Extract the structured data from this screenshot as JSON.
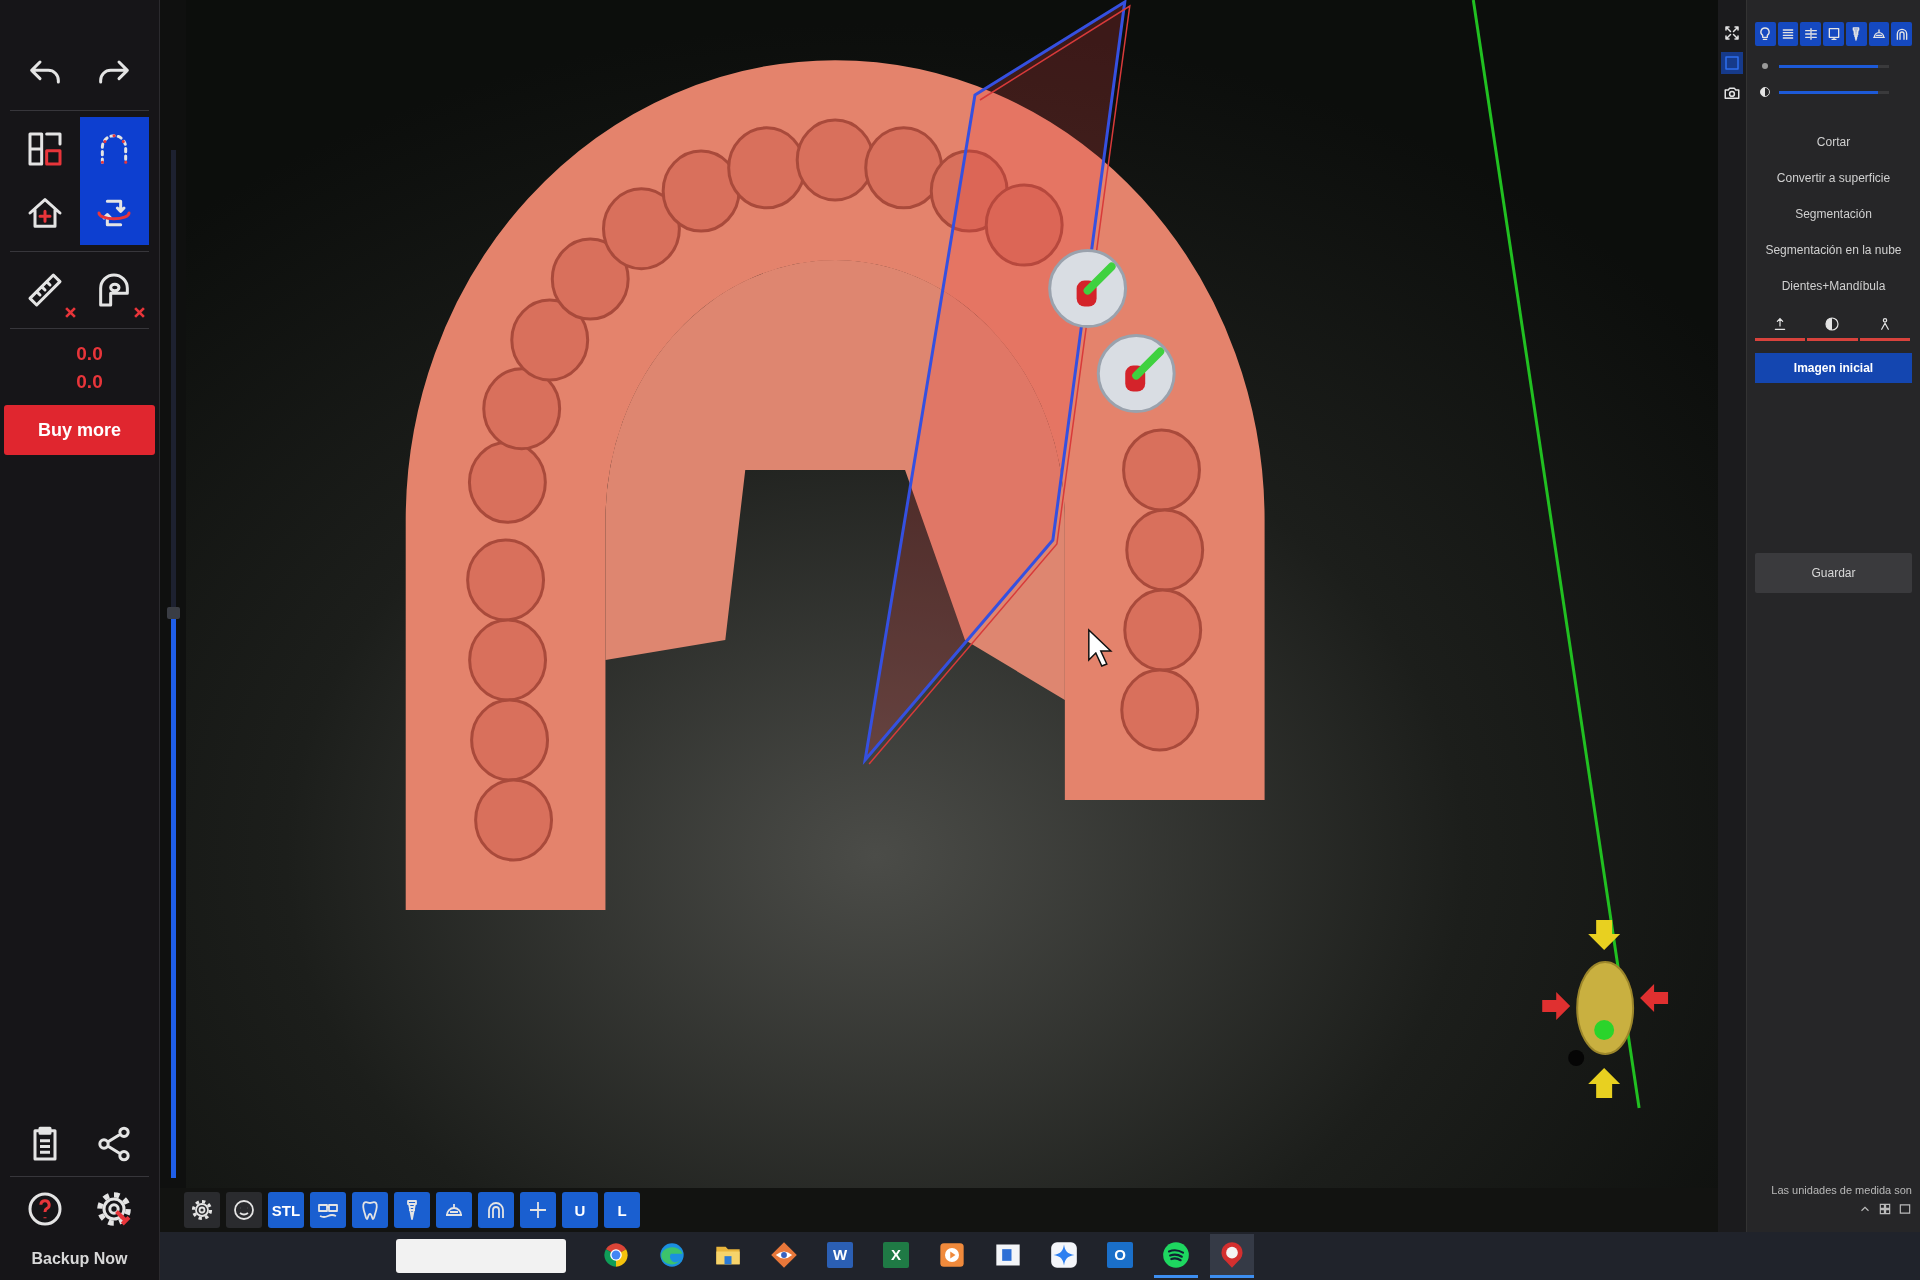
{
  "left_toolbar": {
    "tool_groups": [
      [
        {
          "kind": "undo",
          "selected": false,
          "clear_mark": false
        },
        {
          "kind": "redo",
          "selected": false,
          "clear_mark": false
        }
      ],
      [
        {
          "kind": "layout",
          "selected": false,
          "clear_mark": false
        },
        {
          "kind": "arch",
          "selected": true,
          "clear_mark": false
        },
        {
          "kind": "home",
          "selected": false,
          "clear_mark": false
        },
        {
          "kind": "rotate",
          "selected": true,
          "clear_mark": false
        }
      ],
      [
        {
          "kind": "ruler",
          "selected": false,
          "clear_mark": true
        },
        {
          "kind": "caliper",
          "selected": false,
          "clear_mark": true
        }
      ]
    ],
    "readings": [
      "0.0",
      "0.0"
    ],
    "buy_button": "Buy more",
    "bottom_tools": [
      {
        "kind": "clipboard"
      },
      {
        "kind": "share"
      },
      {
        "kind": "help"
      },
      {
        "kind": "settings"
      }
    ],
    "backup_button": "Backup Now"
  },
  "clip_slider": {
    "level": 0.55
  },
  "app_toolbar": [
    {
      "kind": "gear"
    },
    {
      "kind": "face"
    },
    {
      "kind": "label",
      "label": "STL"
    },
    {
      "kind": "glasses"
    },
    {
      "kind": "tooth"
    },
    {
      "kind": "implant"
    },
    {
      "kind": "dome"
    },
    {
      "kind": "arch2"
    },
    {
      "kind": "add"
    },
    {
      "kind": "label",
      "label": "U"
    },
    {
      "kind": "label",
      "label": "L"
    }
  ],
  "view_strip": [
    {
      "kind": "fit",
      "selected": false
    },
    {
      "kind": "frame",
      "selected": true
    },
    {
      "kind": "camera",
      "selected": false
    }
  ],
  "right_panel": {
    "tabs": [
      {
        "kind": "bulb"
      },
      {
        "kind": "lines"
      },
      {
        "kind": "flow"
      },
      {
        "kind": "screen"
      },
      {
        "kind": "implant"
      },
      {
        "kind": "dome"
      },
      {
        "kind": "arch2"
      }
    ],
    "sliders": [
      {
        "kind": "dot",
        "level": 0.9
      },
      {
        "kind": "contrast",
        "level": 0.9
      }
    ],
    "actions": [
      "Cortar",
      "Convertir a superficie",
      "Segmentación",
      "Segmentación en la nube",
      "Dientes+Mandíbula"
    ],
    "view_tabs": [
      {
        "kind": "upload"
      },
      {
        "kind": "contrast"
      },
      {
        "kind": "figure"
      }
    ],
    "primary_button": "Imagen inicial",
    "save_button": "Guardar",
    "units_note": "Las unidades de medida son"
  },
  "taskbar": {
    "apps": [
      {
        "kind": "ring-logo",
        "running": false,
        "selected": false
      },
      {
        "kind": "swirl",
        "running": false,
        "selected": false
      },
      {
        "kind": "folder",
        "running": false,
        "selected": false
      },
      {
        "kind": "eye-diamond",
        "running": false,
        "selected": false
      },
      {
        "kind": "letter-tile",
        "glyph": "W",
        "color": "#2b5fb4",
        "running": false,
        "selected": false
      },
      {
        "kind": "letter-tile",
        "glyph": "X",
        "color": "#1f7a45",
        "running": false,
        "selected": false
      },
      {
        "kind": "play-tile",
        "running": false,
        "selected": false
      },
      {
        "kind": "window-tile",
        "running": false,
        "selected": false
      },
      {
        "kind": "star-tile",
        "running": false,
        "selected": false
      },
      {
        "kind": "letter-tile",
        "glyph": "O",
        "color": "#1a6fc9",
        "running": false,
        "selected": false
      },
      {
        "kind": "wave-disc",
        "running": true,
        "selected": false
      },
      {
        "kind": "pin-ring",
        "running": true,
        "selected": true
      }
    ]
  }
}
